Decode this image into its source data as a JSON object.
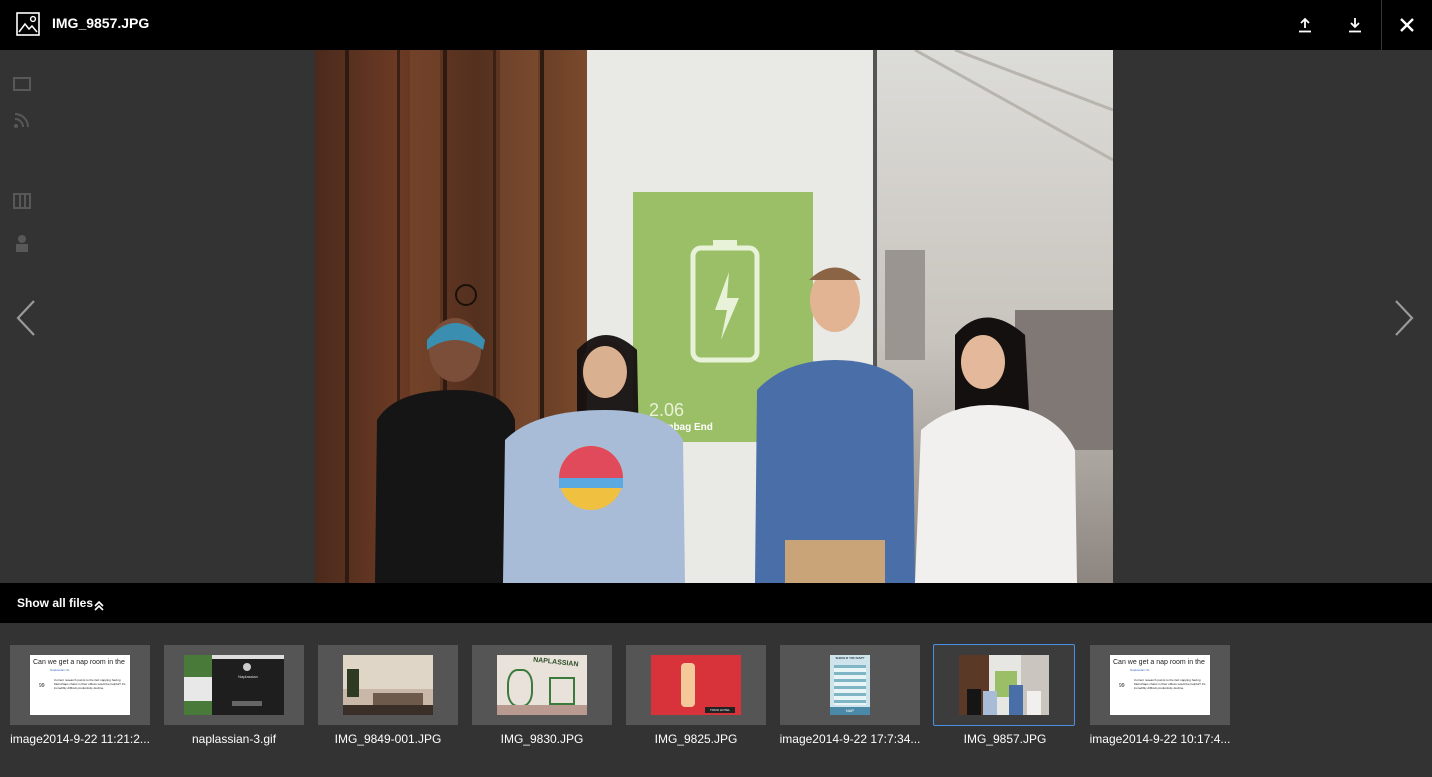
{
  "header": {
    "file_name": "IMG_9857.JPG",
    "icons": {
      "file_type": "image-file-icon",
      "upload": "upload-icon",
      "download": "download-icon",
      "close": "close-icon"
    }
  },
  "viewer": {
    "poster_room_number": "2.06",
    "poster_room_name": "Beanbag End",
    "prev_icon": "chevron-left-icon",
    "next_icon": "chevron-right-icon"
  },
  "files_bar": {
    "label": "Show all files",
    "icon": "double-chevron-up-icon"
  },
  "thumbnails": [
    {
      "name": "image2014-9-22 11:21:2...",
      "kind": "doc"
    },
    {
      "name": "naplassian-3.gif",
      "kind": "app"
    },
    {
      "name": "IMG_9849-001.JPG",
      "kind": "room"
    },
    {
      "name": "IMG_9830.JPG",
      "kind": "whiteboard"
    },
    {
      "name": "IMG_9825.JPG",
      "kind": "red"
    },
    {
      "name": "image2014-9-22 17:7:34...",
      "kind": "infographic"
    },
    {
      "name": "IMG_9857.JPG",
      "kind": "photo",
      "active": true
    },
    {
      "name": "image2014-9-22 10:17:4...",
      "kind": "doc"
    }
  ],
  "doc_thumb": {
    "heading": "Can we get a nap room in the",
    "author": "Naplassian NL",
    "votes": "99",
    "body": "Current research points to the fact napping having MetroNaps chairs in their offices would be helpful? It's incredibly difficult productivity decline."
  },
  "app_thumb": {
    "title": "Naplassian"
  },
  "whiteboard_thumb": {
    "text": "NAPLASSIAN"
  },
  "red_thumb": {
    "text": "TOKIO HOTEL"
  },
  "infographic_thumb": {
    "title": "SHOULD YOU NAP?",
    "footer": "NAP"
  },
  "colors": {
    "header_bg": "#000000",
    "viewer_bg": "#333333",
    "active_thumb_border": "#4a90e2"
  }
}
